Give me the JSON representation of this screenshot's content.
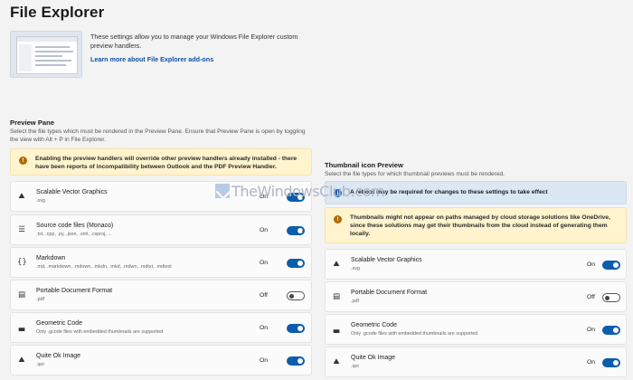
{
  "page": {
    "title": "File Explorer"
  },
  "hero": {
    "description": "These settings allow you to manage your Windows File Explorer custom preview handlers.",
    "link": "Learn more about File Explorer add-ons"
  },
  "preview_pane": {
    "title": "Preview Pane",
    "description": "Select the file types which must be rendered in the Preview Pane. Ensure that Preview Pane is open by toggling the view with Alt + P in File Explorer.",
    "warning": "Enabling the preview handlers will override other preview handlers already installed - there have been reports of incompatibility between Outlook and the PDF Preview Handler.",
    "items": [
      {
        "name": "Scalable Vector Graphics",
        "ext": ".svg",
        "state": "On",
        "on": true,
        "icon": "image-icon",
        "expandable": true
      },
      {
        "name": "Source code files (Monaco)",
        "ext": ".txt, .cpp, .py, .json, .xml, .csproj, ...",
        "state": "On",
        "on": true,
        "icon": "code-file-icon",
        "expandable": true
      },
      {
        "name": "Markdown",
        "ext": ".md, .markdown, .mdown, .mkdn, .mkd, .mdwn, .mdtxt, .mdtext",
        "state": "On",
        "on": true,
        "icon": "markdown-icon",
        "expandable": false
      },
      {
        "name": "Portable Document Format",
        "ext": ".pdf",
        "state": "Off",
        "on": false,
        "icon": "pdf-icon",
        "expandable": false
      },
      {
        "name": "Geometric Code",
        "ext": "Only .gcode files with embedded thumbnails are supported",
        "state": "On",
        "on": true,
        "icon": "chart-icon",
        "expandable": false
      },
      {
        "name": "Quite Ok Image",
        "ext": ".qoi",
        "state": "On",
        "on": true,
        "icon": "image-icon",
        "expandable": false
      }
    ]
  },
  "thumbnail_preview": {
    "title": "Thumbnail icon Preview",
    "description": "Select the file types for which thumbnail previews must be rendered.",
    "info": "A reboot may be required for changes to these settings to take effect",
    "warning": "Thumbnails might not appear on paths managed by cloud storage solutions like OneDrive, since these solutions may get their thumbnails from the cloud instead of generating them locally.",
    "items": [
      {
        "name": "Scalable Vector Graphics",
        "ext": ".svg",
        "state": "On",
        "on": true,
        "icon": "image-icon"
      },
      {
        "name": "Portable Document Format",
        "ext": ".pdf",
        "state": "Off",
        "on": false,
        "icon": "pdf-icon"
      },
      {
        "name": "Geometric Code",
        "ext": "Only .gcode files with embedded thumbnails are supported",
        "state": "On",
        "on": true,
        "icon": "chart-icon"
      },
      {
        "name": "Quite Ok Image",
        "ext": ".qoi",
        "state": "On",
        "on": true,
        "icon": "image-icon"
      }
    ]
  },
  "watermark": {
    "text": "TheWindowsClub.com"
  },
  "colors": {
    "accent": "#0b5cad",
    "warning_bg": "#fff4ce",
    "info_bg": "#dbe7f3",
    "link": "#0f4fa8"
  }
}
